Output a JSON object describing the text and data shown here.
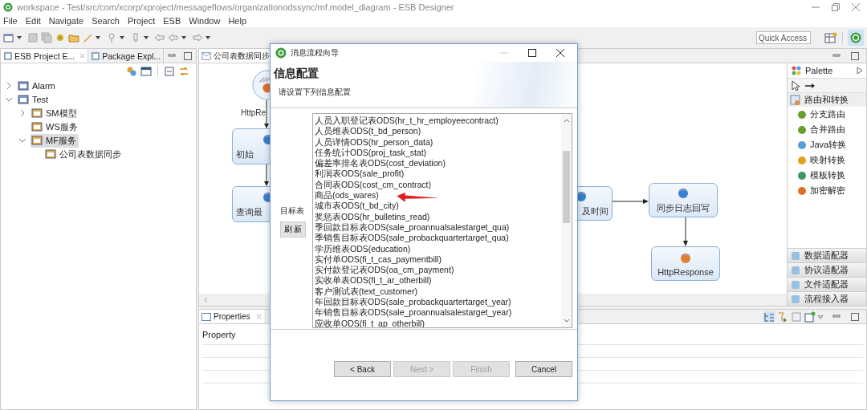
{
  "window": {
    "title": "workspace - Test/src/com/xcorp/xproject/messageflows/organizationodssync/mf.model_diagram - ESB Designer"
  },
  "menu": [
    "File",
    "Edit",
    "Navigate",
    "Search",
    "Project",
    "ESB",
    "Window",
    "Help"
  ],
  "quick_access": {
    "placeholder": "Quick Access"
  },
  "left_tabs": [
    {
      "label": "ESB Project E...",
      "selected": true
    },
    {
      "label": "Package Expl...",
      "selected": false
    }
  ],
  "tree": [
    {
      "label": "Alarm",
      "expanded": false,
      "selected": false
    },
    {
      "label": "Test",
      "expanded": true,
      "selected": false,
      "children": [
        {
          "label": "SM模型",
          "expanded": false,
          "selected": false
        },
        {
          "label": "WS服务",
          "selected": false
        },
        {
          "label": "MF服务",
          "expanded": true,
          "selected": true,
          "children": [
            {
              "label": "公司表数据同步",
              "selected": false
            }
          ]
        }
      ]
    }
  ],
  "editor_tab": {
    "label": "公司表数据同步"
  },
  "diagram": {
    "nodes": [
      {
        "label": "HttpRe",
        "kind": "circle"
      },
      {
        "label": "初始",
        "kind": "box"
      },
      {
        "label": "查询最",
        "kind": "box"
      },
      {
        "label": "及时间",
        "kind": "box"
      },
      {
        "label": "同步日志回写",
        "kind": "box"
      },
      {
        "label": "HttpResponse",
        "kind": "box"
      }
    ]
  },
  "palette": {
    "title": "Palette",
    "groups": [
      {
        "label": "路由和转换",
        "expanded": true,
        "items": [
          "分支路由",
          "合并路由",
          "Java转换",
          "映射转换",
          "模板转换",
          "加密解密"
        ]
      },
      {
        "label": "数据适配器",
        "expanded": false
      },
      {
        "label": "协议适配器",
        "expanded": false
      },
      {
        "label": "文件适配器",
        "expanded": false
      },
      {
        "label": "流程接入器",
        "expanded": false
      }
    ]
  },
  "properties": {
    "tab": "Properties",
    "column": "Property"
  },
  "dialog": {
    "title": "消息流程向导",
    "heading": "信息配置",
    "subtitle": "请设置下列信息配置",
    "field_label": "目标表",
    "refresh_button": "刷 新",
    "options": [
      "人员入职登记表ODS(hr_t_hr_employeecontract)",
      "人员维表ODS(t_bd_person)",
      "人员详情ODS(hr_person_data)",
      "任务统计ODS(proj_task_stat)",
      "偏差率排名表ODS(cost_deviation)",
      "利润表ODS(sale_profit)",
      "合同表ODS(cost_cm_contract)",
      "商品(ods_wares)",
      "城市表ODS(t_bd_city)",
      "奖惩表ODS(hr_bulletins_read)",
      "季回款目标表ODS(sale_proannualsalestarget_qua)",
      "季销售目标表ODS(sale_probackquartertarget_qua)",
      "学历维表ODS(education)",
      "实付单ODS(fi_t_cas_paymentbill)",
      "实付款登记表ODS(oa_cm_payment)",
      "实收单表ODS(fi_t_ar_otherbill)",
      "客户测试表(text_customer)",
      "年回款目标表ODS(sale_probackquartertarget_year)",
      "年销售目标表ODS(sale_proannualsalestarget_year)",
      "应收单ODS(fi_t_ap_otherbill)"
    ],
    "buttons": [
      {
        "label": "< Back",
        "disabled": false
      },
      {
        "label": "Next >",
        "disabled": true
      },
      {
        "label": "Finish",
        "disabled": true
      },
      {
        "label": "Cancel",
        "disabled": false
      }
    ]
  }
}
